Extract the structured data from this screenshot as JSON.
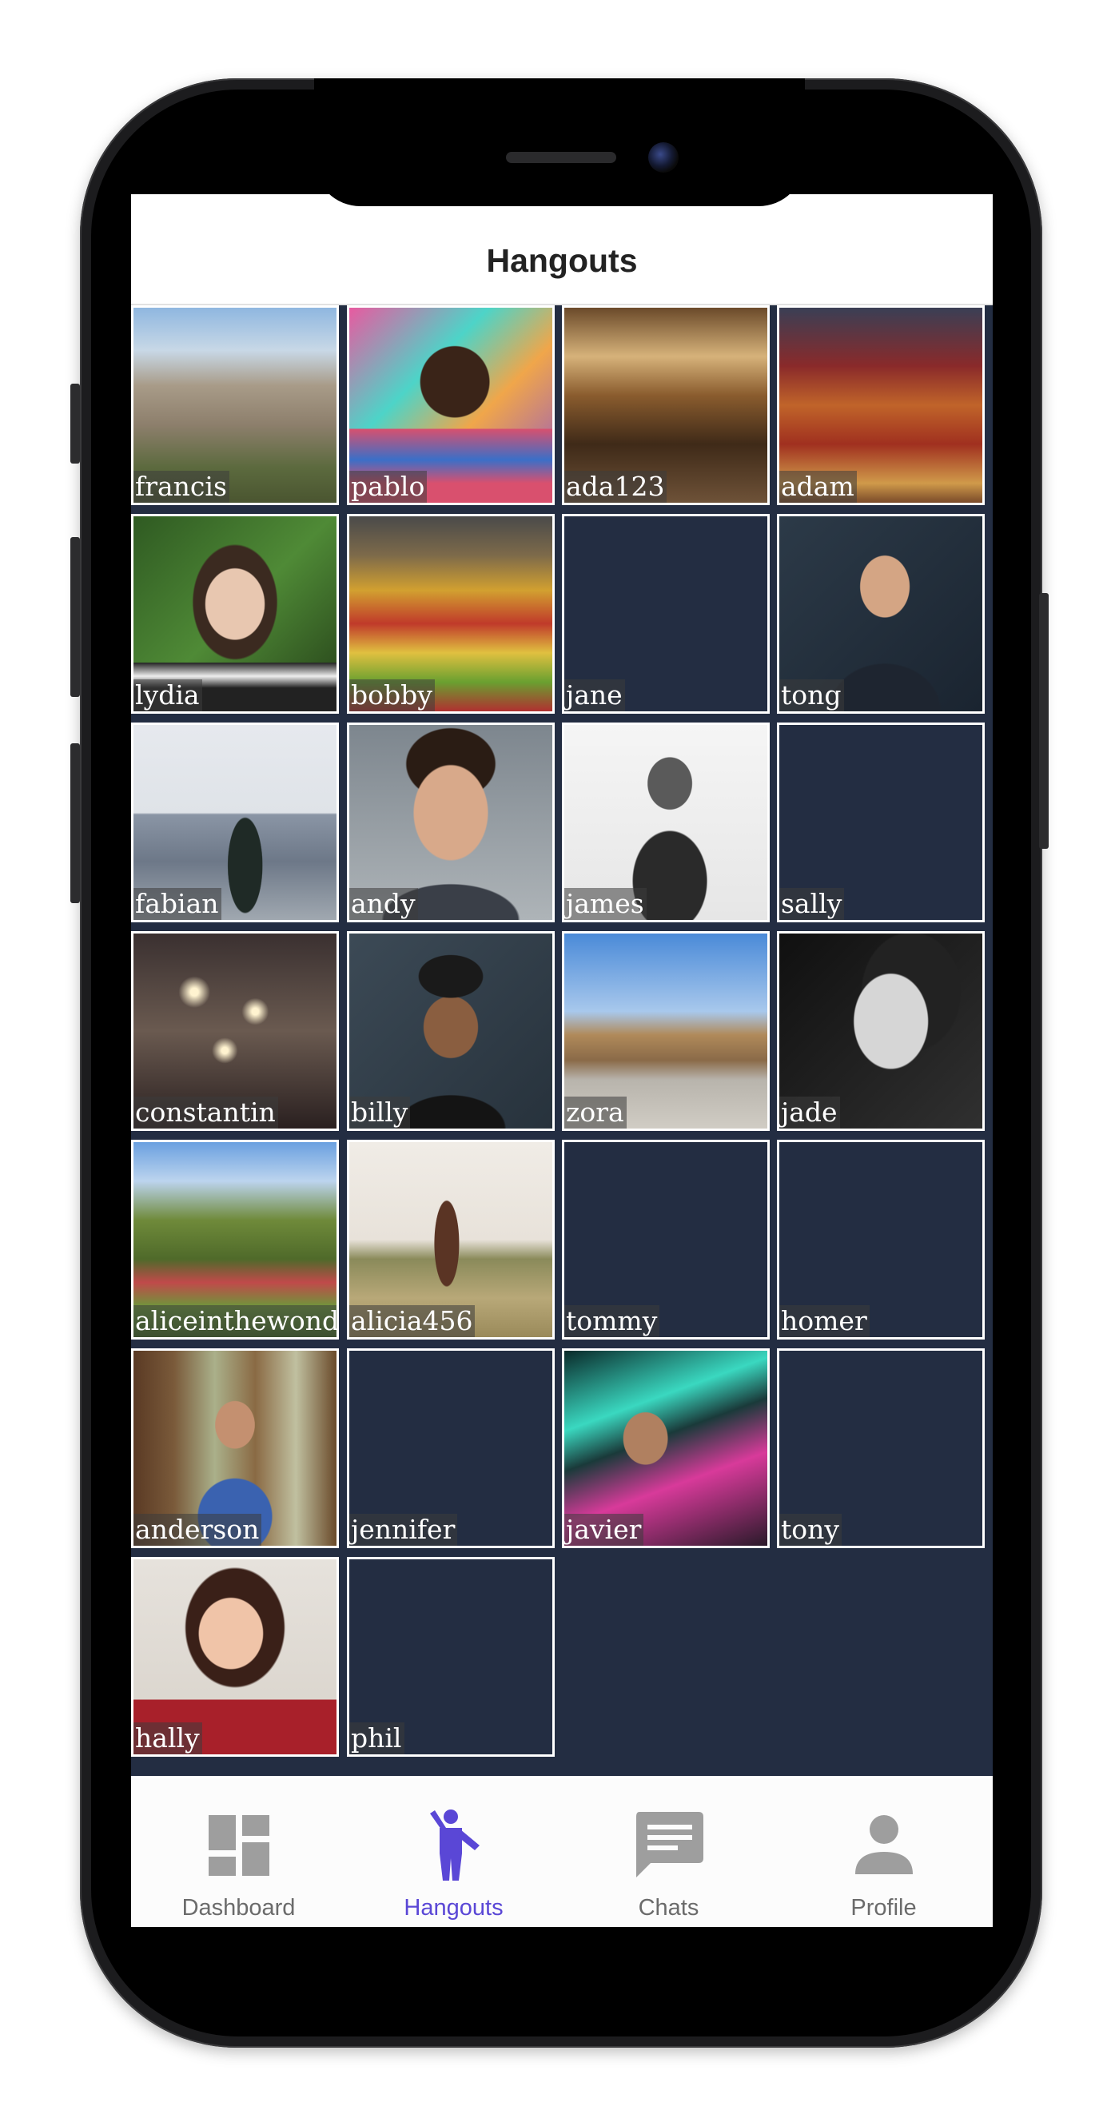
{
  "header": {
    "title": "Hangouts"
  },
  "grid": {
    "tiles": [
      {
        "username": "francis",
        "photo": "city-overlook"
      },
      {
        "username": "pablo",
        "photo": "graffiti-portrait"
      },
      {
        "username": "ada123",
        "photo": "market-hall"
      },
      {
        "username": "adam",
        "photo": "market-stall"
      },
      {
        "username": "lydia",
        "photo": "forest-portrait"
      },
      {
        "username": "bobby",
        "photo": "fruit-stand"
      },
      {
        "username": "jane",
        "photo": "none"
      },
      {
        "username": "tong",
        "photo": "dark-portrait"
      },
      {
        "username": "fabian",
        "photo": "skyline-portrait"
      },
      {
        "username": "andy",
        "photo": "studio-portrait"
      },
      {
        "username": "james",
        "photo": "bw-portrait"
      },
      {
        "username": "sally",
        "photo": "none"
      },
      {
        "username": "constantin",
        "photo": "street-lights"
      },
      {
        "username": "billy",
        "photo": "beanie-portrait"
      },
      {
        "username": "zora",
        "photo": "plaza"
      },
      {
        "username": "jade",
        "photo": "bw-profile"
      },
      {
        "username": "aliceinthewonde",
        "photo": "castle-garden"
      },
      {
        "username": "alicia456",
        "photo": "field-portrait"
      },
      {
        "username": "tommy",
        "photo": "none"
      },
      {
        "username": "homer",
        "photo": "none"
      },
      {
        "username": "anderson",
        "photo": "forest-cap-portrait"
      },
      {
        "username": "jennifer",
        "photo": "none"
      },
      {
        "username": "javier",
        "photo": "neon-portrait"
      },
      {
        "username": "tony",
        "photo": "none"
      },
      {
        "username": "hally",
        "photo": "smile-portrait"
      },
      {
        "username": "phil",
        "photo": "none"
      }
    ]
  },
  "tabbar": {
    "tabs": [
      {
        "label": "Dashboard",
        "icon": "dashboard-icon"
      },
      {
        "label": "Hangouts",
        "icon": "person-waving-icon",
        "active": true
      },
      {
        "label": "Chats",
        "icon": "chat-bubble-icon"
      },
      {
        "label": "Profile",
        "icon": "person-icon"
      }
    ]
  },
  "colors": {
    "accent": "#5a47d6",
    "tile_empty": "#232d42",
    "tab_inactive": "#6b6b6b",
    "icon_inactive": "#9e9e9e"
  }
}
